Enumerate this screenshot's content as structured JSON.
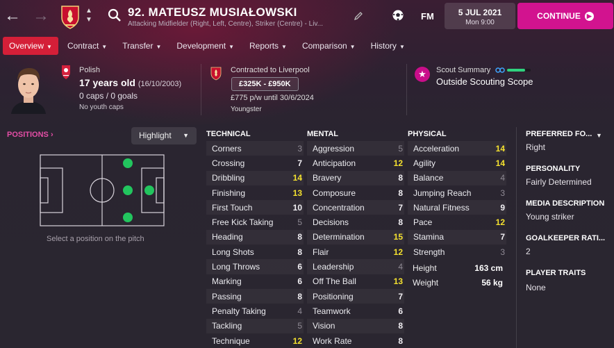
{
  "header": {
    "player_name": "92. MATEUSZ MUSIAŁOWSKI",
    "player_desc": "Attacking Midfielder (Right, Left, Centre), Striker (Centre) - Liv...",
    "fm_label": "FM",
    "date": "5 JUL 2021",
    "time": "Mon 9:00",
    "continue_label": "CONTINUE",
    "icons": [
      "back-arrow-icon",
      "forward-arrow-icon",
      "club-crest-icon",
      "up-down-icon",
      "search-icon",
      "pencil-icon",
      "football-icon"
    ]
  },
  "tabs": [
    {
      "label": "Overview",
      "active": true
    },
    {
      "label": "Contract"
    },
    {
      "label": "Transfer"
    },
    {
      "label": "Development"
    },
    {
      "label": "Reports"
    },
    {
      "label": "Comparison"
    },
    {
      "label": "History"
    }
  ],
  "info": {
    "nationality": "Polish",
    "age": "17 years old",
    "dob": "(16/10/2003)",
    "caps": "0 caps / 0 goals",
    "youth_caps": "No youth caps",
    "contract": "Contracted to Liverpool",
    "value": "£325K - £950K",
    "wage": "£775 p/w until 30/6/2024",
    "status": "Youngster",
    "scout_title": "Scout Summary",
    "scout_summary": "Outside Scouting Scope",
    "scout_knowledge": 0.75
  },
  "positions": {
    "title": "POSITIONS",
    "highlight_label": "Highlight",
    "note": "Select a position on the pitch"
  },
  "attributes": {
    "technical": {
      "title": "TECHNICAL",
      "items": [
        {
          "name": "Corners",
          "value": "3"
        },
        {
          "name": "Crossing",
          "value": "7"
        },
        {
          "name": "Dribbling",
          "value": "14"
        },
        {
          "name": "Finishing",
          "value": "13"
        },
        {
          "name": "First Touch",
          "value": "10"
        },
        {
          "name": "Free Kick Taking",
          "value": "5"
        },
        {
          "name": "Heading",
          "value": "8"
        },
        {
          "name": "Long Shots",
          "value": "8"
        },
        {
          "name": "Long Throws",
          "value": "6"
        },
        {
          "name": "Marking",
          "value": "6"
        },
        {
          "name": "Passing",
          "value": "8"
        },
        {
          "name": "Penalty Taking",
          "value": "4"
        },
        {
          "name": "Tackling",
          "value": "5"
        },
        {
          "name": "Technique",
          "value": "12"
        }
      ]
    },
    "mental": {
      "title": "MENTAL",
      "items": [
        {
          "name": "Aggression",
          "value": "5"
        },
        {
          "name": "Anticipation",
          "value": "12"
        },
        {
          "name": "Bravery",
          "value": "8"
        },
        {
          "name": "Composure",
          "value": "8"
        },
        {
          "name": "Concentration",
          "value": "7"
        },
        {
          "name": "Decisions",
          "value": "8"
        },
        {
          "name": "Determination",
          "value": "15"
        },
        {
          "name": "Flair",
          "value": "12"
        },
        {
          "name": "Leadership",
          "value": "4"
        },
        {
          "name": "Off The Ball",
          "value": "13"
        },
        {
          "name": "Positioning",
          "value": "7"
        },
        {
          "name": "Teamwork",
          "value": "6"
        },
        {
          "name": "Vision",
          "value": "8"
        },
        {
          "name": "Work Rate",
          "value": "8"
        }
      ]
    },
    "physical": {
      "title": "PHYSICAL",
      "items": [
        {
          "name": "Acceleration",
          "value": "14"
        },
        {
          "name": "Agility",
          "value": "14"
        },
        {
          "name": "Balance",
          "value": "4"
        },
        {
          "name": "Jumping Reach",
          "value": "3"
        },
        {
          "name": "Natural Fitness",
          "value": "9"
        },
        {
          "name": "Pace",
          "value": "12"
        },
        {
          "name": "Stamina",
          "value": "7"
        },
        {
          "name": "Strength",
          "value": "3"
        }
      ],
      "height_label": "Height",
      "height": "163 cm",
      "weight_label": "Weight",
      "weight": "56 kg"
    }
  },
  "right_panel": {
    "preferred_foot_title": "PREFERRED FO...",
    "preferred_foot": "Right",
    "personality_title": "PERSONALITY",
    "personality": "Fairly Determined",
    "media_title": "MEDIA DESCRIPTION",
    "media": "Young striker",
    "gk_title": "GOALKEEPER RATI...",
    "gk": "2",
    "traits_title": "PLAYER TRAITS",
    "traits": "None"
  },
  "colors": {
    "accent": "#d2138f",
    "tab_active": "#d41f38",
    "good_attr": "#f4e12f",
    "position_dot": "#22c55e"
  }
}
